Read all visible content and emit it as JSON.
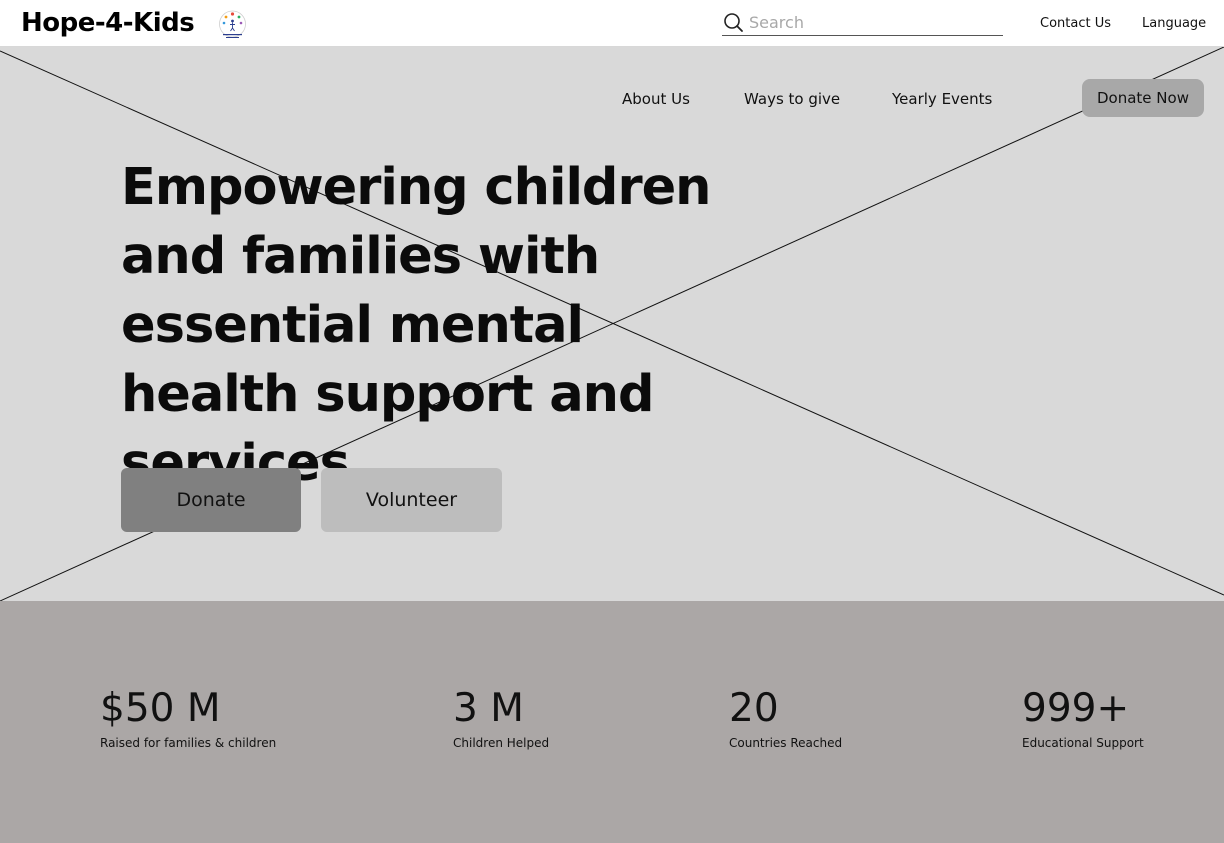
{
  "header": {
    "brand": "Hope-4-Kids",
    "search_placeholder": "Search",
    "contact_label": "Contact Us",
    "language_label": "Language"
  },
  "nav": {
    "items": [
      {
        "label": "About Us"
      },
      {
        "label": "Ways to give"
      },
      {
        "label": "Yearly Events"
      }
    ],
    "donate_now_label": "Donate Now"
  },
  "hero": {
    "headline": "Empowering children and families with essential mental health support and services.",
    "donate_label": "Donate",
    "volunteer_label": "Volunteer"
  },
  "stats": [
    {
      "value": "$50 M",
      "label": "Raised for families & children"
    },
    {
      "value": "3 M",
      "label": "Children Helped"
    },
    {
      "value": "20",
      "label": "Countries Reached"
    },
    {
      "value": "999+",
      "label": "Educational Support"
    }
  ],
  "colors": {
    "hero_background": "#d9d9d9",
    "stats_background": "#aba7a6",
    "donate_button": "#808080",
    "volunteer_button": "#bdbdbd",
    "donate_now_button": "#a8a8a8"
  },
  "icons": {
    "search": "search-icon",
    "logo": "hope-4-kids-logo"
  }
}
